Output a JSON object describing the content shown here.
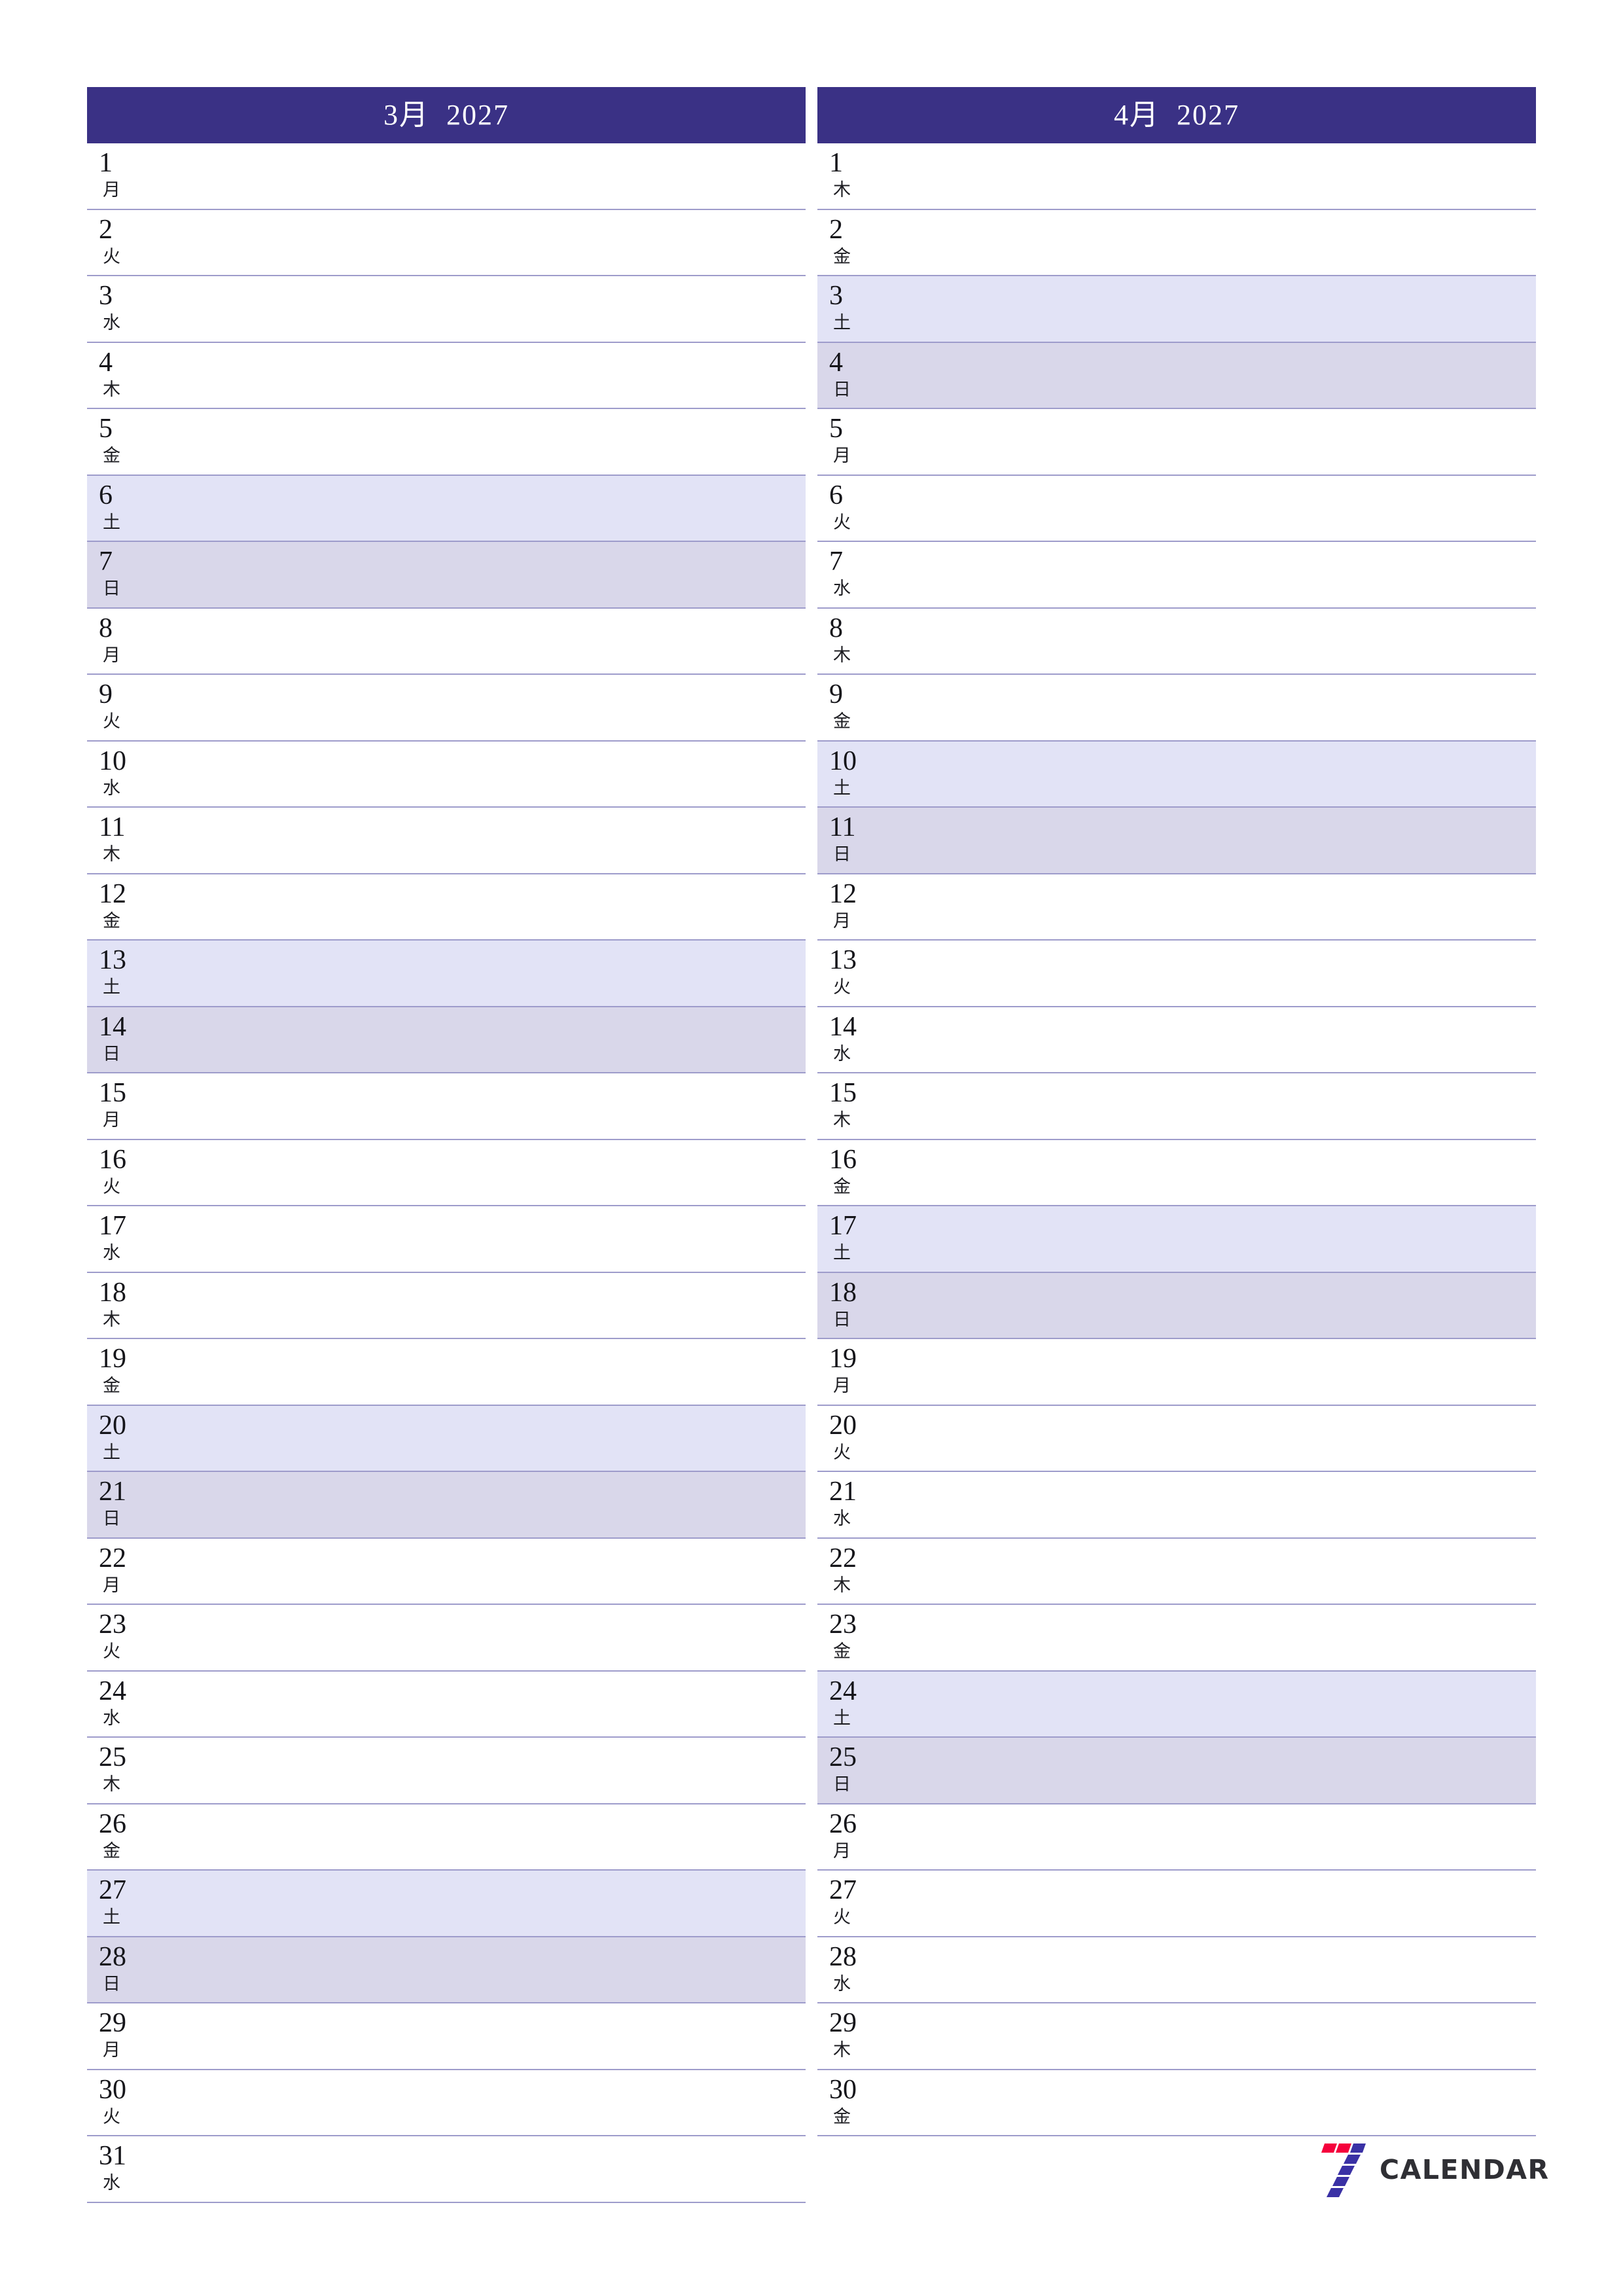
{
  "document": {
    "type": "monthly-planner",
    "page_size": "2480x3508",
    "locale": "ja"
  },
  "theme": {
    "header_bg": "#3a3185",
    "header_text": "#ffffff",
    "rule_color": "#9e9ccb",
    "saturday_bg": "#e2e3f6",
    "sunday_bg": "#d9d7ea",
    "day_text": "#15151a",
    "logo_red": "#f5003c",
    "logo_purple": "#3a31a5",
    "logo_word_color": "#2f2f34"
  },
  "months": [
    {
      "title": "3月  2027",
      "month_label": "3月",
      "year": "2027",
      "days": [
        {
          "num": "1",
          "wd": "月",
          "kind": "weekday"
        },
        {
          "num": "2",
          "wd": "火",
          "kind": "weekday"
        },
        {
          "num": "3",
          "wd": "水",
          "kind": "weekday"
        },
        {
          "num": "4",
          "wd": "木",
          "kind": "weekday"
        },
        {
          "num": "5",
          "wd": "金",
          "kind": "weekday"
        },
        {
          "num": "6",
          "wd": "土",
          "kind": "sat"
        },
        {
          "num": "7",
          "wd": "日",
          "kind": "sun"
        },
        {
          "num": "8",
          "wd": "月",
          "kind": "weekday"
        },
        {
          "num": "9",
          "wd": "火",
          "kind": "weekday"
        },
        {
          "num": "10",
          "wd": "水",
          "kind": "weekday"
        },
        {
          "num": "11",
          "wd": "木",
          "kind": "weekday"
        },
        {
          "num": "12",
          "wd": "金",
          "kind": "weekday"
        },
        {
          "num": "13",
          "wd": "土",
          "kind": "sat"
        },
        {
          "num": "14",
          "wd": "日",
          "kind": "sun"
        },
        {
          "num": "15",
          "wd": "月",
          "kind": "weekday"
        },
        {
          "num": "16",
          "wd": "火",
          "kind": "weekday"
        },
        {
          "num": "17",
          "wd": "水",
          "kind": "weekday"
        },
        {
          "num": "18",
          "wd": "木",
          "kind": "weekday"
        },
        {
          "num": "19",
          "wd": "金",
          "kind": "weekday"
        },
        {
          "num": "20",
          "wd": "土",
          "kind": "sat"
        },
        {
          "num": "21",
          "wd": "日",
          "kind": "sun"
        },
        {
          "num": "22",
          "wd": "月",
          "kind": "weekday"
        },
        {
          "num": "23",
          "wd": "火",
          "kind": "weekday"
        },
        {
          "num": "24",
          "wd": "水",
          "kind": "weekday"
        },
        {
          "num": "25",
          "wd": "木",
          "kind": "weekday"
        },
        {
          "num": "26",
          "wd": "金",
          "kind": "weekday"
        },
        {
          "num": "27",
          "wd": "土",
          "kind": "sat"
        },
        {
          "num": "28",
          "wd": "日",
          "kind": "sun"
        },
        {
          "num": "29",
          "wd": "月",
          "kind": "weekday"
        },
        {
          "num": "30",
          "wd": "火",
          "kind": "weekday"
        },
        {
          "num": "31",
          "wd": "水",
          "kind": "weekday"
        }
      ]
    },
    {
      "title": "4月  2027",
      "month_label": "4月",
      "year": "2027",
      "days": [
        {
          "num": "1",
          "wd": "木",
          "kind": "weekday"
        },
        {
          "num": "2",
          "wd": "金",
          "kind": "weekday"
        },
        {
          "num": "3",
          "wd": "土",
          "kind": "sat"
        },
        {
          "num": "4",
          "wd": "日",
          "kind": "sun"
        },
        {
          "num": "5",
          "wd": "月",
          "kind": "weekday"
        },
        {
          "num": "6",
          "wd": "火",
          "kind": "weekday"
        },
        {
          "num": "7",
          "wd": "水",
          "kind": "weekday"
        },
        {
          "num": "8",
          "wd": "木",
          "kind": "weekday"
        },
        {
          "num": "9",
          "wd": "金",
          "kind": "weekday"
        },
        {
          "num": "10",
          "wd": "土",
          "kind": "sat"
        },
        {
          "num": "11",
          "wd": "日",
          "kind": "sun"
        },
        {
          "num": "12",
          "wd": "月",
          "kind": "weekday"
        },
        {
          "num": "13",
          "wd": "火",
          "kind": "weekday"
        },
        {
          "num": "14",
          "wd": "水",
          "kind": "weekday"
        },
        {
          "num": "15",
          "wd": "木",
          "kind": "weekday"
        },
        {
          "num": "16",
          "wd": "金",
          "kind": "weekday"
        },
        {
          "num": "17",
          "wd": "土",
          "kind": "sat"
        },
        {
          "num": "18",
          "wd": "日",
          "kind": "sun"
        },
        {
          "num": "19",
          "wd": "月",
          "kind": "weekday"
        },
        {
          "num": "20",
          "wd": "火",
          "kind": "weekday"
        },
        {
          "num": "21",
          "wd": "水",
          "kind": "weekday"
        },
        {
          "num": "22",
          "wd": "木",
          "kind": "weekday"
        },
        {
          "num": "23",
          "wd": "金",
          "kind": "weekday"
        },
        {
          "num": "24",
          "wd": "土",
          "kind": "sat"
        },
        {
          "num": "25",
          "wd": "日",
          "kind": "sun"
        },
        {
          "num": "26",
          "wd": "月",
          "kind": "weekday"
        },
        {
          "num": "27",
          "wd": "火",
          "kind": "weekday"
        },
        {
          "num": "28",
          "wd": "水",
          "kind": "weekday"
        },
        {
          "num": "29",
          "wd": "木",
          "kind": "weekday"
        },
        {
          "num": "30",
          "wd": "金",
          "kind": "weekday"
        }
      ]
    }
  ],
  "footer": {
    "logo_mark": "seven-logo-icon",
    "logo_word": "CALENDAR"
  }
}
